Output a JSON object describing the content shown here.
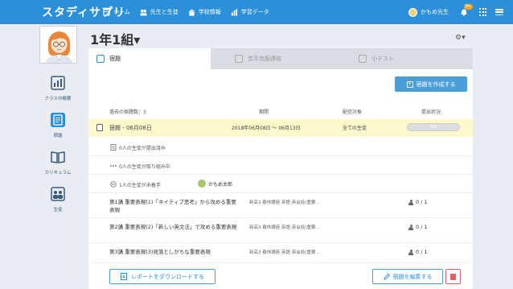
{
  "app": {
    "logo": "スタディサプリ"
  },
  "nav": [
    {
      "label": "ホーム",
      "icon": "home-icon"
    },
    {
      "label": "先生と生徒",
      "icon": "people-icon"
    },
    {
      "label": "学校情報",
      "icon": "school-icon"
    },
    {
      "label": "学習データ",
      "icon": "chart-icon"
    }
  ],
  "user": {
    "name": "かもめ先生",
    "notification_count": "9+"
  },
  "sidebar": {
    "items": [
      {
        "label": "クラスの概要",
        "icon": "overview-icon"
      },
      {
        "label": "宿題",
        "icon": "homework-icon"
      },
      {
        "label": "カリキュラム",
        "icon": "book-icon"
      },
      {
        "label": "生徒",
        "icon": "students-icon"
      }
    ]
  },
  "header": {
    "class_title": "1年1組▾",
    "settings": "⚙▾"
  },
  "tabs": [
    {
      "label": "宿題",
      "active": true
    },
    {
      "label": "苦手克服連絡",
      "active": false
    },
    {
      "label": "小テスト",
      "active": false
    }
  ],
  "create_button": "宿題を作成する",
  "table_head": {
    "count": "過去の宿題数：3",
    "period": "期間",
    "target": "配信対象",
    "status": "提出状況"
  },
  "homework": {
    "title": "宿題 - 06月08日",
    "period": "2018年06月08日 ～ 06月13日",
    "target": "全ての生徒",
    "progress_text": "0/1",
    "progress_ratio": 0
  },
  "status_rows": [
    {
      "label": "0人の生徒が提出済み"
    },
    {
      "label": "0人の生徒が取り組み中"
    },
    {
      "label": "1人の生徒が未着手"
    }
  ],
  "student_chip": "かもめ太郎",
  "questions": [
    {
      "title": "第1講 重要表現(1)「ネイティブ思考」から攻める重要表現",
      "meta": "新高3 春休講座 英語 英会話(重要…",
      "score": "0 / 1"
    },
    {
      "title": "第2講 重要表現(2)「新しい英文法」で攻める重要表現",
      "meta": "新高3 春休講座 英語 英会話(重要…",
      "score": "0 / 1"
    },
    {
      "title": "第3講 重要表現(3)見落としがちな重要表現",
      "meta": "新高3 春休講座 英語 英会話(重要…",
      "score": "0 / 1"
    }
  ],
  "bottom": {
    "download": "レポートをダウンロードする",
    "edit": "宿題を編集する"
  },
  "colors": {
    "accent": "#2b90d9",
    "highlight": "#fdf9cd",
    "danger": "#e06060"
  }
}
